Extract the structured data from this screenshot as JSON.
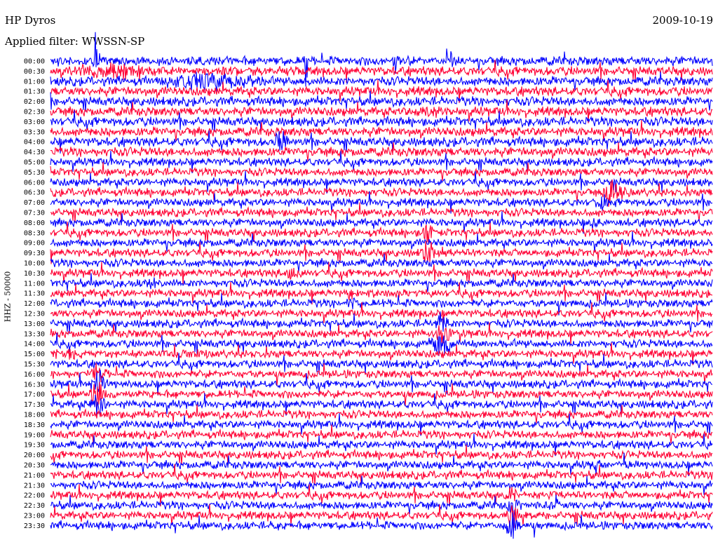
{
  "header": {
    "station": "HP Dyros",
    "date": "2009-10-19",
    "filter": "Applied filter: WWSSN-SP"
  },
  "chart_data": {
    "type": "line",
    "title": "HP Dyros",
    "date": "2009-10-19",
    "filter": "Applied filter: WWSSN-SP",
    "ylabel": "HHZ - 50000",
    "row_labels": [
      "00:00",
      "00:30",
      "01:00",
      "01:30",
      "02:00",
      "02:30",
      "03:00",
      "03:30",
      "04:00",
      "04:30",
      "05:00",
      "05:30",
      "06:00",
      "06:30",
      "07:00",
      "07:30",
      "08:00",
      "08:30",
      "09:00",
      "09:30",
      "10:00",
      "10:30",
      "11:00",
      "11:30",
      "12:00",
      "12:30",
      "13:00",
      "13:30",
      "14:00",
      "14:30",
      "15:00",
      "15:30",
      "16:00",
      "16:30",
      "17:00",
      "17:30",
      "18:00",
      "18:30",
      "19:00",
      "19:30",
      "20:00",
      "20:30",
      "21:00",
      "21:30",
      "22:00",
      "22:30",
      "23:00",
      "23:30"
    ],
    "display_labels": [
      "00:00",
      "00:30",
      "01:00",
      "01:30",
      "02:00",
      "02:30",
      "03:00",
      "03:30",
      "04:00",
      "04:30",
      "05:00",
      "05:30",
      "06:00",
      "06:30",
      "07:00",
      "07:30",
      "08:00",
      "08:30",
      "09:00",
      "09:30",
      "10:00",
      "10:30",
      "11:00",
      "11:30",
      "12:00",
      "12:30",
      "13:00",
      "13:30",
      "14:00",
      "15:00",
      "15:30",
      "16:00",
      "16:30",
      "17:00",
      "17:30",
      "18:00",
      "18:30",
      "19:00",
      "19:30",
      "20:00",
      "20:30",
      "21:00",
      "21:30",
      "22:00",
      "22:30",
      "23:00",
      "23:30"
    ],
    "row_minutes": 30,
    "trace_colors": [
      "#0000ff",
      "#ff0033"
    ],
    "background": "#ffffff"
  }
}
